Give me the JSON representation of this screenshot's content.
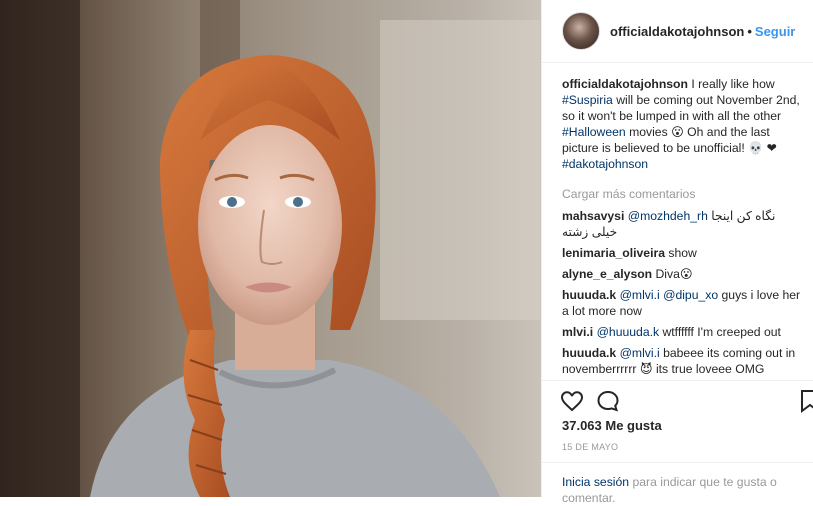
{
  "post": {
    "username": "officialdakotajohnson",
    "follow_label": "Seguir",
    "dot": "•",
    "caption": {
      "user": "officialdakotajohnson",
      "text_1": " I really like how ",
      "tag_1": "#Suspiria",
      "text_2": " will be coming out November 2nd, so it won't be lumped in with all the other ",
      "tag_2": "#Halloween",
      "text_3": " movies 😮 Oh and the last picture is believed to be unofficial! 💀 ❤ ",
      "tag_3": "#dakotajohnson"
    },
    "load_more": "Cargar más comentarios",
    "comments": [
      {
        "user": "mahsavysi",
        "mention": "@mozhdeh_rh",
        "text": " نگاه کن اینجا خیلی زشته"
      },
      {
        "user": "lenimaria_oliveira",
        "mention": "",
        "text": " show"
      },
      {
        "user": "alyne_e_alyson",
        "mention": "",
        "text": " Diva😮"
      },
      {
        "user": "huuuda.k",
        "mention": "@mlvi.i @dipu_xo",
        "text": " guys i love her a lot more now"
      },
      {
        "user": "mlvi.i",
        "mention": "@huuuda.k",
        "text": " wtffffff I'm creeped out"
      },
      {
        "user": "huuuda.k",
        "mention": "@mlvi.i",
        "text": " babeee its coming out in novemberrrrrr 😈 its true loveee OMG"
      }
    ],
    "likes": "37.063 Me gusta",
    "date": "15 DE MAYO",
    "login_link": "Inicia sesión",
    "login_text": " para indicar que te gusta o comentar."
  },
  "colors": {
    "link": "#003569",
    "follow": "#3897f0",
    "muted": "#999999",
    "hair": "#c8622b"
  },
  "icons": [
    "heart-icon",
    "comment-icon",
    "save-icon"
  ]
}
